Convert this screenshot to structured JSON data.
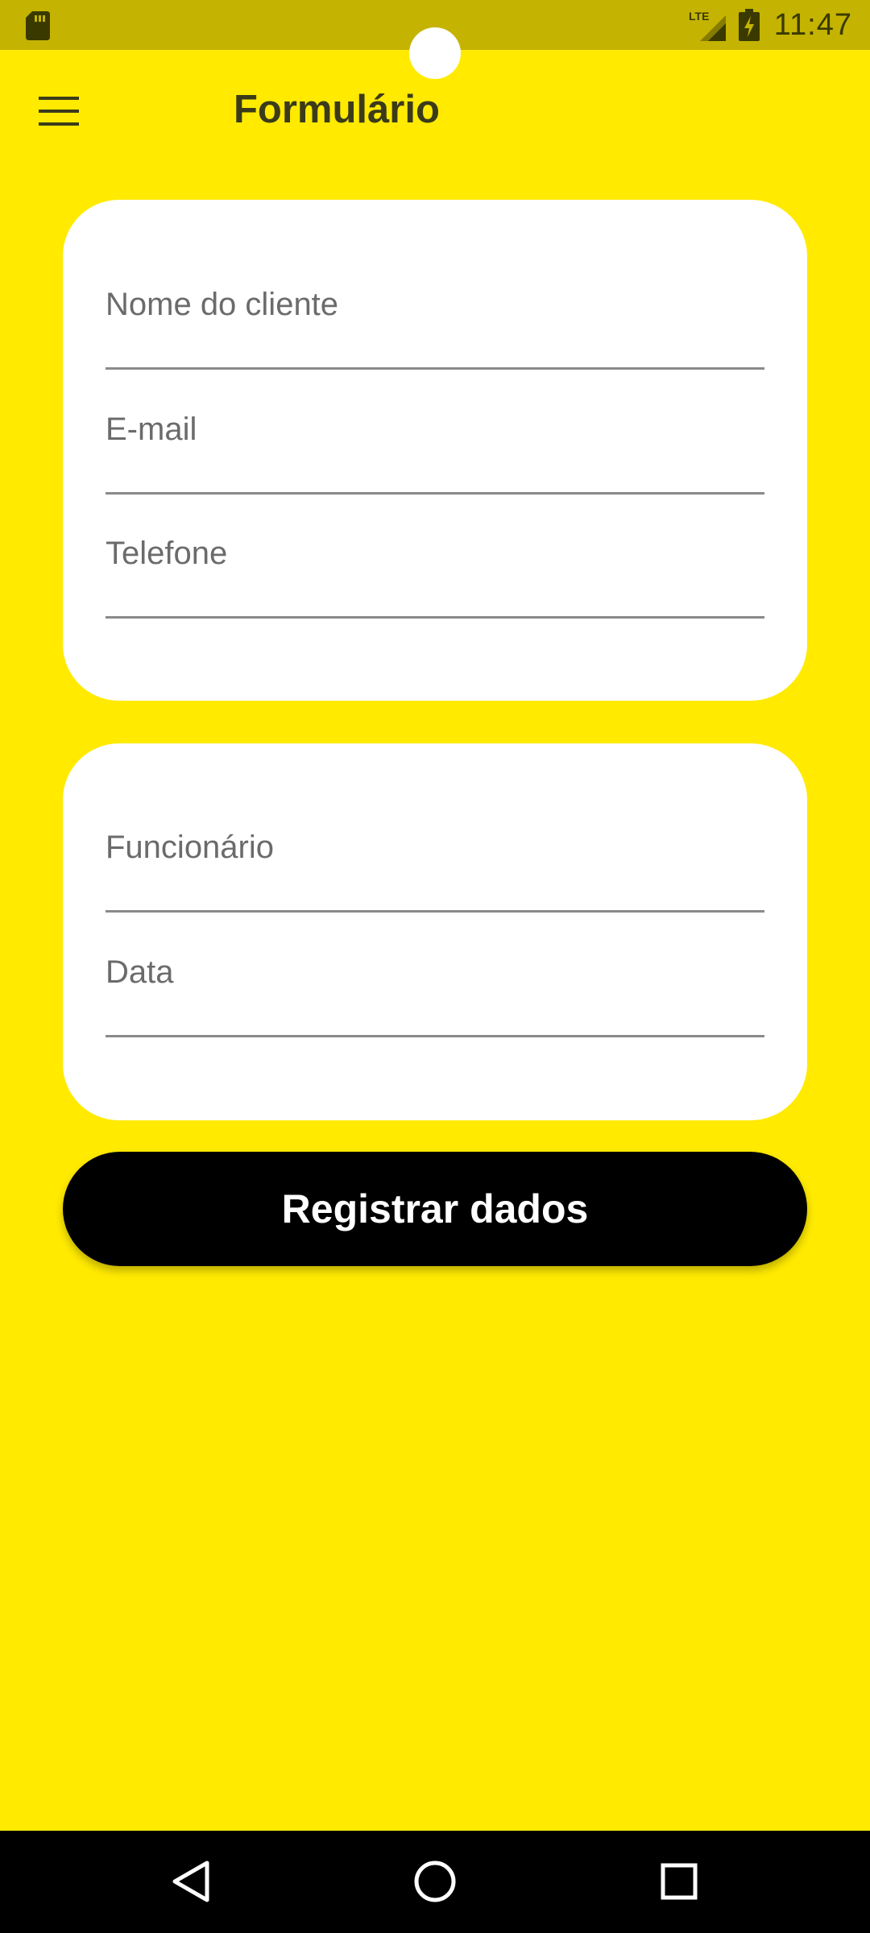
{
  "status_bar": {
    "time": "11:47",
    "network": "LTE",
    "icons": [
      "sd-card-icon",
      "lte-signal-icon",
      "battery-charging-icon"
    ]
  },
  "app_bar": {
    "title": "Formulário",
    "menu_icon": "menu-icon"
  },
  "client_card": {
    "fields": [
      {
        "label": "Nome do cliente",
        "value": ""
      },
      {
        "label": "E-mail",
        "value": ""
      },
      {
        "label": "Telefone",
        "value": ""
      }
    ]
  },
  "employee_card": {
    "fields": [
      {
        "label": "Funcionário",
        "value": ""
      },
      {
        "label": "Data",
        "value": ""
      }
    ]
  },
  "actions": {
    "register_label": "Registrar dados"
  },
  "nav_bar": {
    "icons": [
      "back-icon",
      "home-icon",
      "recents-icon"
    ]
  },
  "colors": {
    "background": "#FFEA00",
    "status_bar": "#C4B300",
    "card": "#FFFFFF",
    "button": "#000000",
    "button_text": "#FFFFFF",
    "label": "#6B6B6B"
  }
}
